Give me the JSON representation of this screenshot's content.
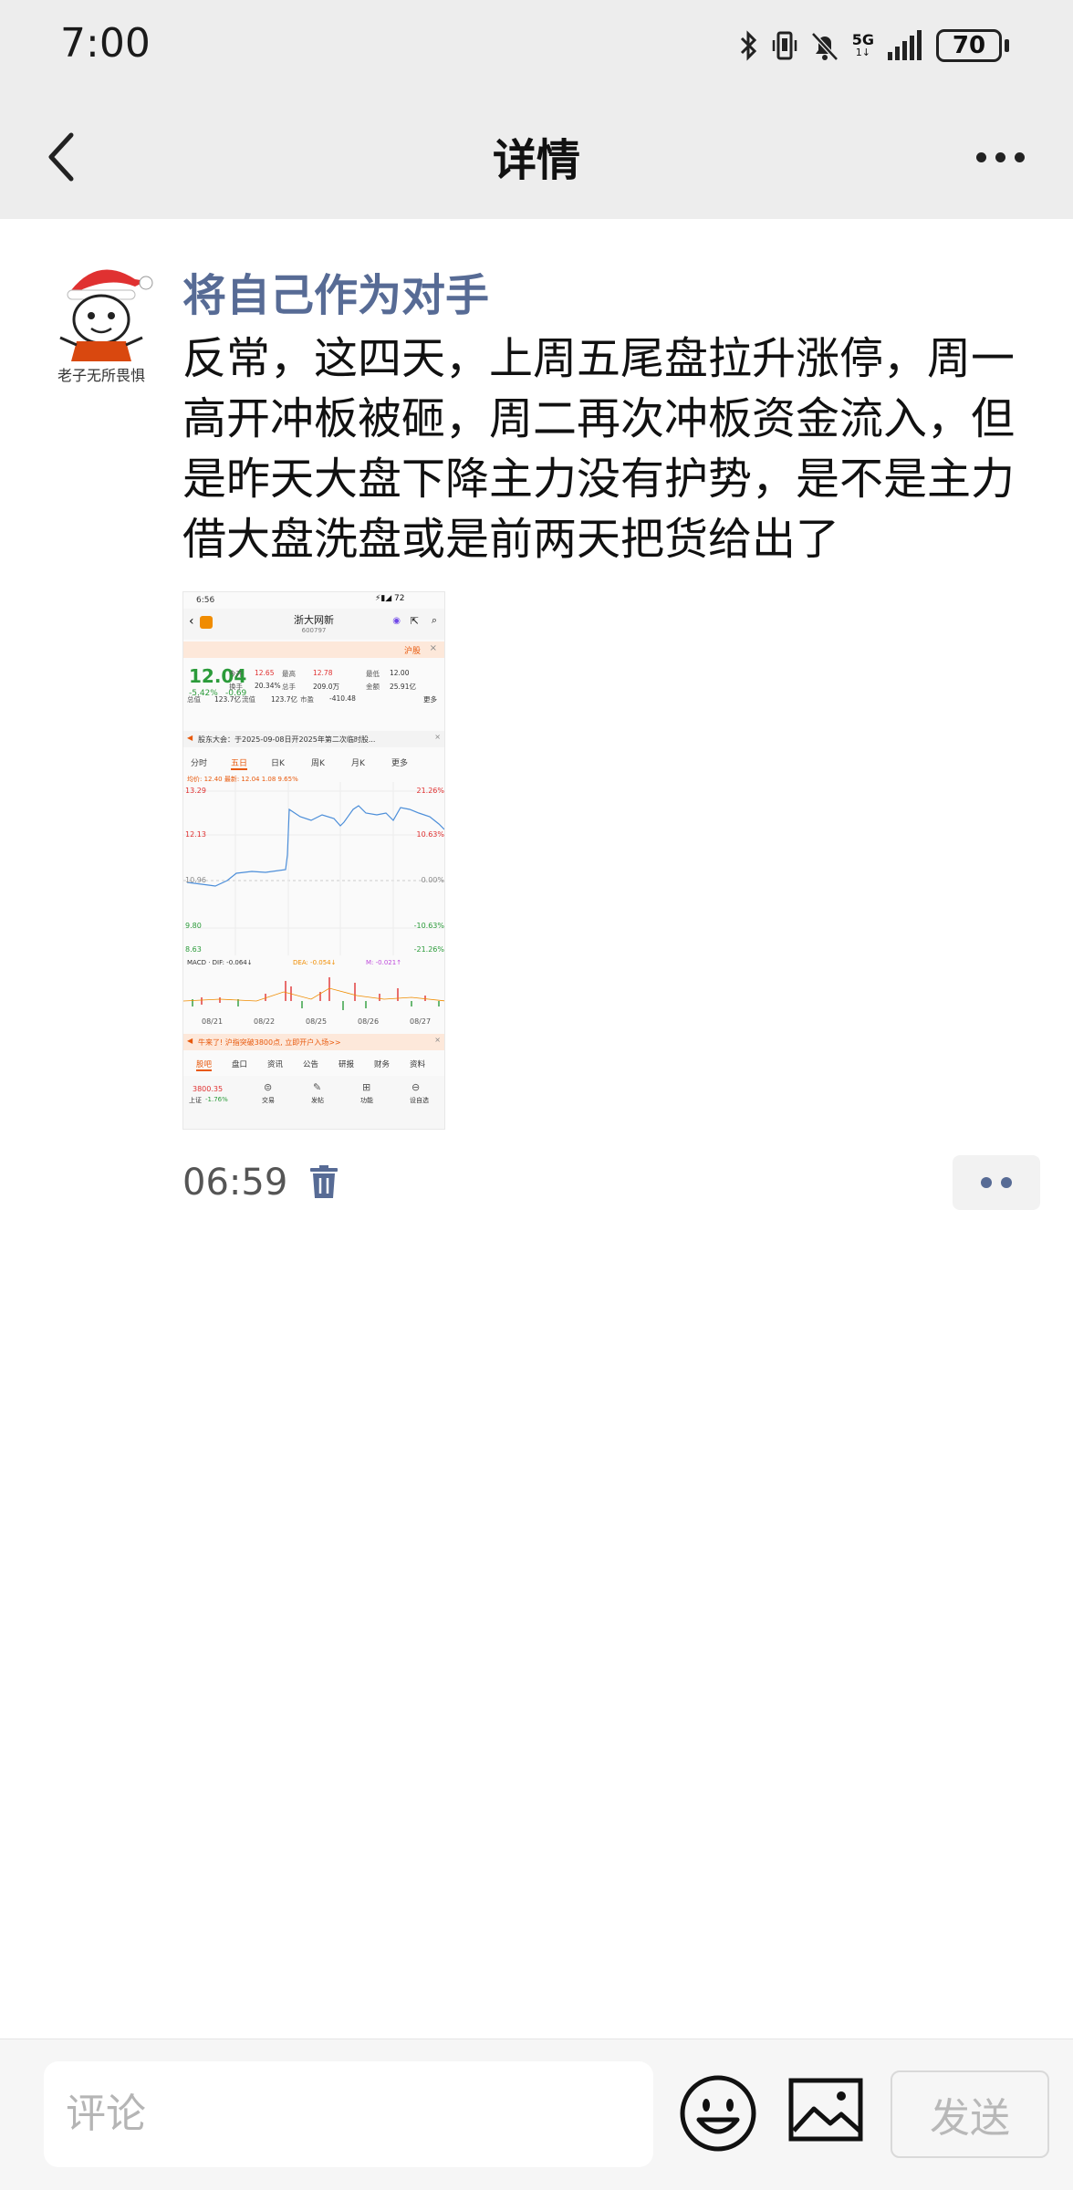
{
  "status_bar": {
    "time": "7:00",
    "network": "5G",
    "battery": "70",
    "icons": [
      "bluetooth-icon",
      "vibrate-icon",
      "mute-bell-icon",
      "signal-icon",
      "battery-icon"
    ]
  },
  "nav": {
    "title": "详情",
    "icons": [
      "chevron-left-icon",
      "more-dots-icon"
    ]
  },
  "post": {
    "author": "将自己作为对手",
    "avatar_caption": "老子无所畏惧",
    "text": "反常，这四天，上周五尾盘拉升涨停，周一高开冲板被砸，周二再次冲板资金流入，但是昨天大盘下降主力没有护势，是不是主力借大盘洗盘或是前两天把货给出了",
    "time": "06:59"
  },
  "screenshot": {
    "time": "6:56",
    "stock_name": "浙大网新",
    "stock_code": "600797",
    "tag": "沪股",
    "price": "12.04",
    "change": "-5.42%",
    "change_abs": "-0.69",
    "stats": [
      [
        "今开",
        "12.65",
        "最高",
        "12.78",
        "最低",
        "12.00"
      ],
      [
        "换手",
        "20.34%",
        "总手",
        "209.0万",
        "金额",
        "25.91亿"
      ],
      [
        "总值",
        "123.7亿",
        "流值",
        "123.7亿",
        "市盈",
        "-410.48"
      ]
    ],
    "more": "更多",
    "notice": "股东大会：于2025-09-08日开2025年第二次临时股...",
    "tabs": [
      "分时",
      "五日",
      "日K",
      "周K",
      "月K",
      "更多"
    ],
    "active_tab": "五日",
    "chart_header": "均价: 12.40  最新: 12.04  1.08  9.65%",
    "y_left": [
      "13.29",
      "12.13",
      "10.96",
      "9.80",
      "8.63"
    ],
    "y_right": [
      "21.26%",
      "10.63%",
      "0.00%",
      "-10.63%",
      "-21.26%"
    ],
    "macd": "MACD · DIF: -0.064↓",
    "dea": "DEA: -0.054↓",
    "m": "M: -0.021↑",
    "x_labels": [
      "08/21",
      "08/22",
      "08/25",
      "08/26",
      "08/27"
    ],
    "banner": "牛来了! 沪指突破3800点, 立即开户入场>>",
    "bottom_tabs": [
      "股吧",
      "盘口",
      "资讯",
      "公告",
      "研报",
      "财务",
      "资料"
    ],
    "index_value": "3800.35",
    "index_name": "上证",
    "index_change": "-1.76%",
    "dock": [
      "交易",
      "发帖",
      "功能",
      "设自选"
    ]
  },
  "bottom_bar": {
    "comment_placeholder": "评论",
    "send_label": "发送",
    "icons": [
      "emoji-icon",
      "image-icon"
    ]
  }
}
